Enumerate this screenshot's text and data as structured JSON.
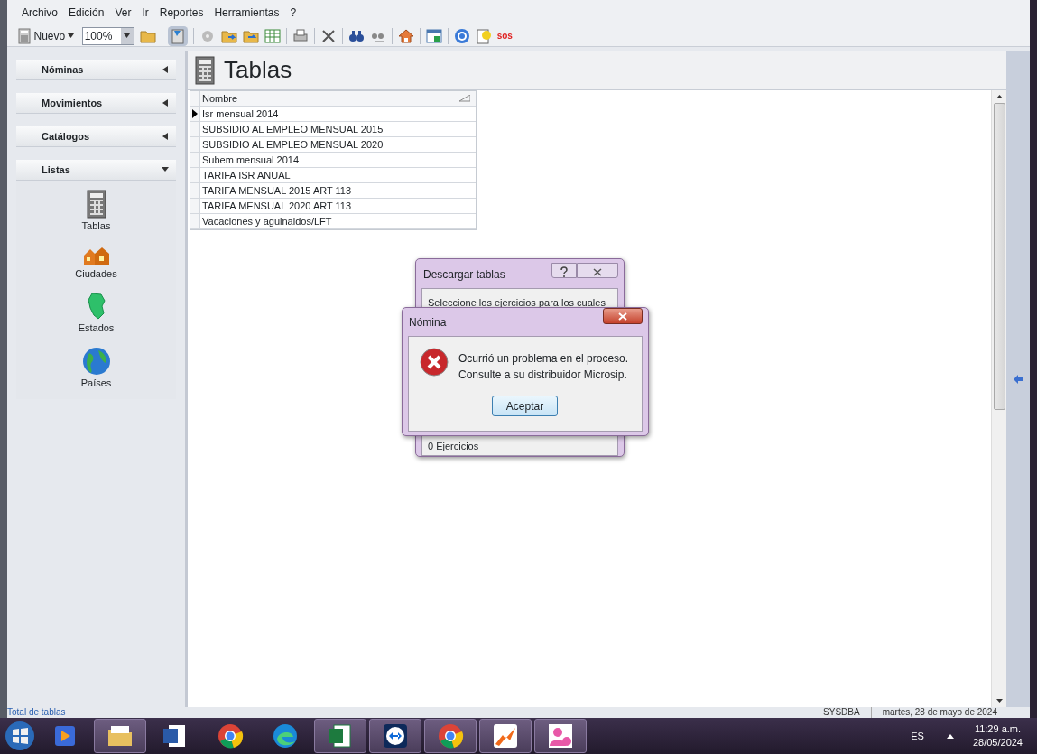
{
  "menu": [
    "Archivo",
    "Edición",
    "Ver",
    "Ir",
    "Reportes",
    "Herramientas",
    "?"
  ],
  "toolbar": {
    "new_button": "Nuevo",
    "zoom": "100%",
    "view_toggle": {
      "selected": true
    },
    "sos": "sos"
  },
  "sidebar": {
    "sections": [
      {
        "label": "Nóminas",
        "expanded": false
      },
      {
        "label": "Movimientos",
        "expanded": false
      },
      {
        "label": "Catálogos",
        "expanded": false
      },
      {
        "label": "Listas",
        "expanded": true,
        "items": [
          {
            "label": "Tablas",
            "kind": "table"
          },
          {
            "label": "Ciudades",
            "kind": "city"
          },
          {
            "label": "Estados",
            "kind": "state"
          },
          {
            "label": "Países",
            "kind": "globe"
          }
        ]
      }
    ]
  },
  "page_title": "Tablas",
  "table": {
    "columns": [
      "Nombre"
    ],
    "rows": [
      {
        "name": "Isr mensual 2014",
        "selected": true
      },
      {
        "name": "SUBSIDIO AL EMPLEO MENSUAL 2015",
        "selected": false
      },
      {
        "name": "SUBSIDIO AL EMPLEO MENSUAL 2020",
        "selected": false
      },
      {
        "name": "Subem mensual 2014",
        "selected": false
      },
      {
        "name": "TARIFA ISR ANUAL",
        "selected": false
      },
      {
        "name": "TARIFA MENSUAL 2015 ART 113",
        "selected": false
      },
      {
        "name": "TARIFA MENSUAL 2020 ART 113",
        "selected": false
      },
      {
        "name": "Vacaciones y aguinaldos/LFT",
        "selected": false
      }
    ]
  },
  "back_dialog": {
    "title": "Descargar tablas",
    "text": "Seleccione los ejercicios para los cuales",
    "footer": "0 Ejercicios"
  },
  "error_dialog": {
    "title": "Nómina",
    "message": [
      "Ocurrió un problema en el proceso.",
      "Consulte a su distribuidor Microsip."
    ],
    "button": "Aceptar"
  },
  "status_bar": {
    "left": "Total de tablas",
    "user": "SYSDBA",
    "date": "martes, 28 de mayo de 2024"
  },
  "taskbar": {
    "apps": [
      {
        "kind": "media",
        "running": false
      },
      {
        "kind": "folder",
        "running": true
      },
      {
        "kind": "word",
        "running": false
      },
      {
        "kind": "chrome",
        "running": false
      },
      {
        "kind": "edge",
        "running": false
      },
      {
        "kind": "excel",
        "running": true
      },
      {
        "kind": "remote",
        "running": true
      },
      {
        "kind": "chrome",
        "running": true
      },
      {
        "kind": "chart",
        "running": true
      },
      {
        "kind": "user",
        "running": true
      }
    ],
    "language": "ES",
    "time": "11:29 a.m.",
    "date": "28/05/2024"
  }
}
